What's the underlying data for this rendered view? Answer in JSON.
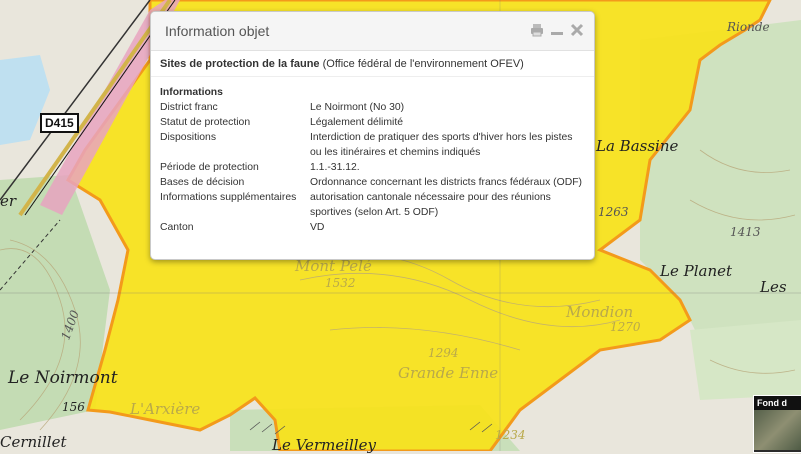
{
  "popup": {
    "title": "Information objet",
    "layer_name": "Sites de protection de la faune",
    "layer_source": "(Office fédéral de l'environnement OFEV)",
    "section_heading": "Informations",
    "rows": [
      {
        "key": "District franc",
        "value": "Le Noirmont (No 30)"
      },
      {
        "key": "Statut de protection",
        "value": "Légalement délimité"
      },
      {
        "key": "Dispositions",
        "value": "Interdiction de pratiquer des sports d'hiver hors les pistes ou les itinéraires et chemins indiqués"
      },
      {
        "key": "Période de protection",
        "value": "1.1.-31.12."
      },
      {
        "key": "Bases de décision",
        "value": "Ordonnance concernant les districts francs fédéraux (ODF)"
      },
      {
        "key": "Informations supplémentaires",
        "value": "autorisation cantonale nécessaire pour des réunions sportives (selon Art. 5 ODF)"
      },
      {
        "key": "Canton",
        "value": "VD"
      }
    ],
    "icons": [
      "print-icon",
      "minimize-icon",
      "close-icon"
    ]
  },
  "map": {
    "road_badge": "D415",
    "labels": {
      "le_noirmont": "Le Noirmont",
      "cernillet": "Cernillet",
      "le_vermeilley": "Le Vermeilley",
      "le_planet": "Le Planet",
      "les": "Les",
      "la_bassine": "La Bassine",
      "rionde": "Rionde",
      "mont_pele": "Mont Pelé",
      "grande_enne": "Grande Enne",
      "mondion": "Mondion",
      "l_arxiere": "L'Arxière",
      "er": "er",
      "alt_1532": "1532",
      "alt_1294": "1294",
      "alt_1270": "1270",
      "alt_1263": "1263",
      "alt_1413": "1413",
      "alt_1400": "1400",
      "alt_1234": "1234",
      "alt_156": "156"
    },
    "colors": {
      "protected_area": "#f7e21a",
      "area_border": "#f39a1b",
      "terrain": "#e9e6dc",
      "forest": "#c4dcb4"
    }
  },
  "fond": {
    "label": "Fond d"
  }
}
